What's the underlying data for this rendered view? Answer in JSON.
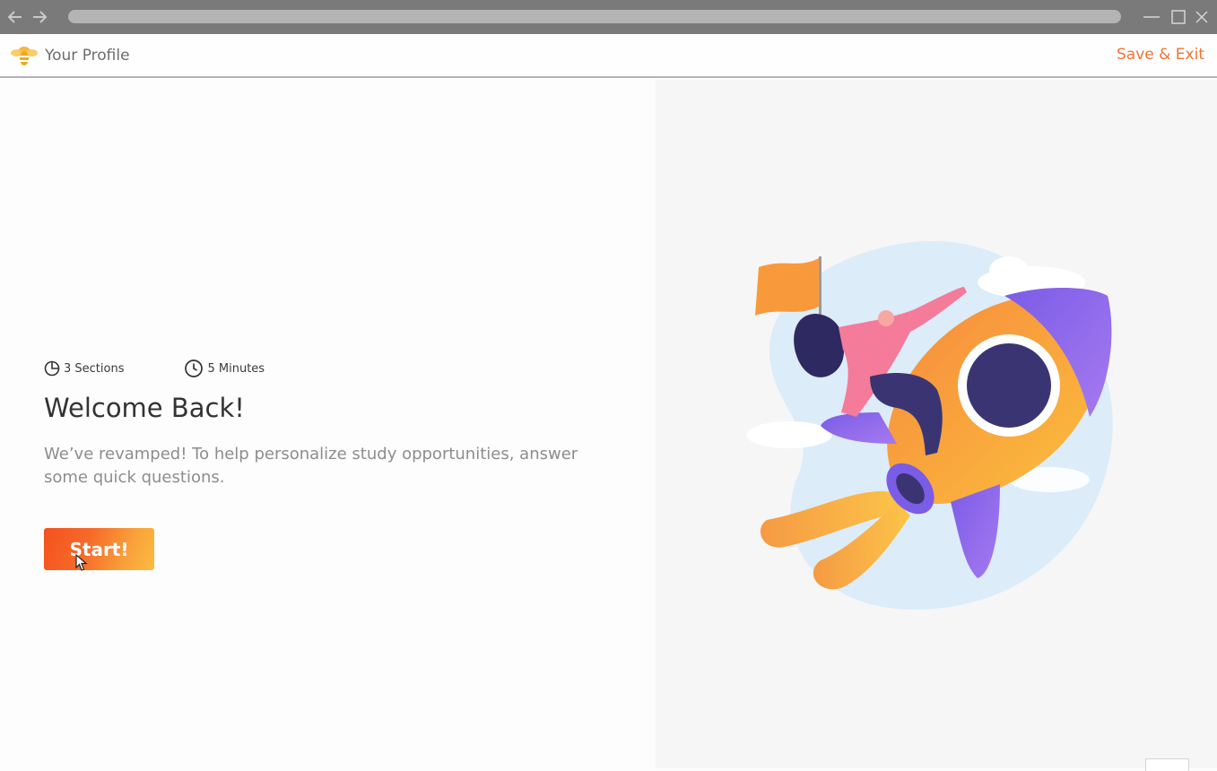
{
  "browser": {
    "back_icon": "arrow-left-icon",
    "forward_icon": "arrow-right-icon",
    "window_controls": [
      "minimize-icon",
      "maximize-icon",
      "close-icon"
    ]
  },
  "header": {
    "logo_icon": "bee-logo-icon",
    "title": "Your Profile",
    "save_exit_label": "Save & Exit",
    "accent_color": "#f47234"
  },
  "intro": {
    "sections_label": "3 Sections",
    "sections_icon": "pie-chart-icon",
    "time_label": "5 Minutes",
    "time_icon": "clock-icon",
    "heading": "Welcome Back!",
    "description": "We’ve revamped! To help personalize study opportunities, answer some quick questions.",
    "start_label": "Start!",
    "start_gradient": [
      "#f4511e",
      "#fbbc40"
    ]
  },
  "illustration": {
    "icon": "rocket-rider-illustration"
  },
  "footer_chip": {
    "label": ""
  }
}
